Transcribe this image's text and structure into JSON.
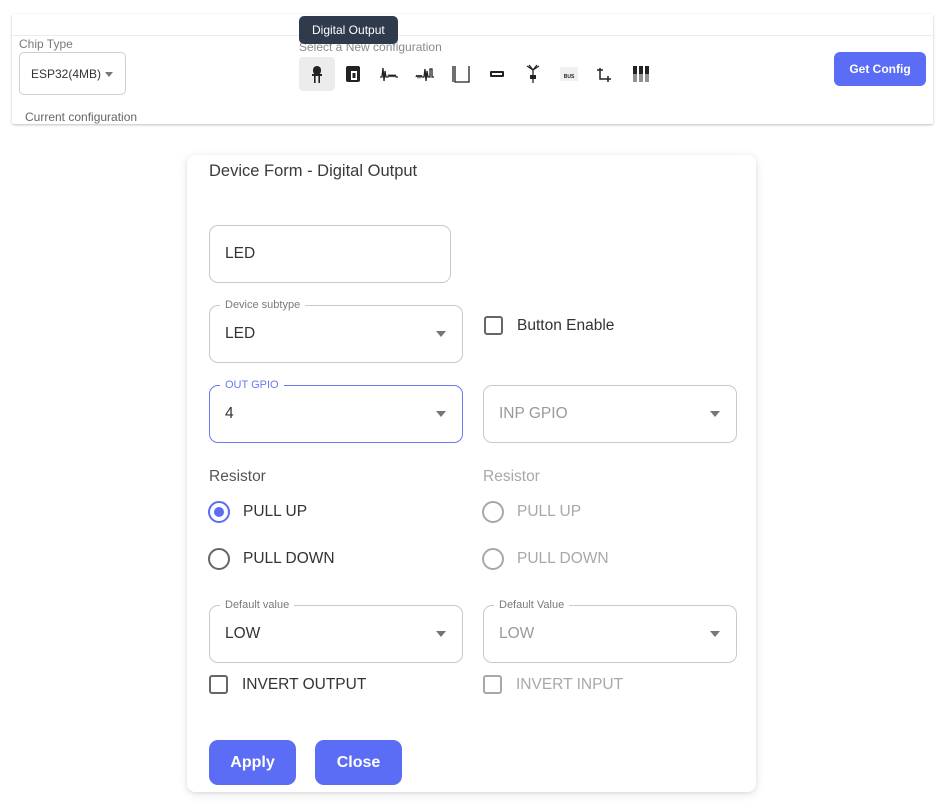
{
  "toolbar": {
    "chip_type_label": "Chip Type",
    "chip_type_value": "ESP32(4MB)",
    "current_configuration_label": "Current configuration",
    "select_new_label": "Select a New configuration",
    "tooltip": "Digital Output",
    "get_config_label": "Get Config",
    "device_icons": [
      "digital-output-icon",
      "relay-icon",
      "analog-signal-icon",
      "pwm-signal-icon",
      "square-wave-icon",
      "display-icon",
      "antenna-icon",
      "bus-icon",
      "transistor-icon",
      "multi-pin-connector-icon"
    ],
    "bus_icon_text": "BUS"
  },
  "form": {
    "title": "Device Form - Digital Output",
    "name_value": "LED",
    "device_subtype": {
      "label": "Device subtype",
      "value": "LED"
    },
    "button_enable_label": "Button Enable",
    "out_gpio": {
      "label": "OUT GPIO",
      "value": "4"
    },
    "inp_gpio": {
      "placeholder": "INP GPIO"
    },
    "resistor_left": {
      "label": "Resistor",
      "options": [
        "PULL UP",
        "PULL DOWN"
      ],
      "selected": "PULL UP"
    },
    "resistor_right": {
      "label": "Resistor",
      "options": [
        "PULL UP",
        "PULL DOWN"
      ]
    },
    "default_value_left": {
      "label": "Default value",
      "value": "LOW"
    },
    "default_value_right": {
      "label": "Default Value",
      "value": "LOW"
    },
    "invert_output_label": "INVERT OUTPUT",
    "invert_input_label": "INVERT INPUT",
    "apply_label": "Apply",
    "close_label": "Close"
  },
  "colors": {
    "accent": "#5b6cf5",
    "tooltip_bg": "#2f3a4d"
  }
}
